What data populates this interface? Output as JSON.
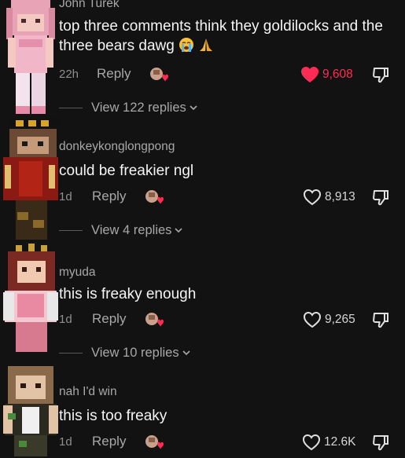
{
  "comments": [
    {
      "username": "John Turek",
      "text": "top three comments think they goldilocks and the three bears dawg",
      "emojis": [
        "loudly-crying-face-emoji",
        "folded-hands-emoji"
      ],
      "time": "22h",
      "reply_label": "Reply",
      "likes": "9,608",
      "liked": true,
      "view_replies": "View 122 replies"
    },
    {
      "username": "donkeykonglongpong",
      "text": "could be freakier ngl",
      "time": "1d",
      "reply_label": "Reply",
      "likes": "8,913",
      "liked": false,
      "view_replies": "View 4 replies"
    },
    {
      "username": "myuda",
      "text": "this is freaky enough",
      "time": "1d",
      "reply_label": "Reply",
      "likes": "9,265",
      "liked": false,
      "view_replies": "View 10 replies"
    },
    {
      "username": "nah I'd win",
      "text": "this is too freaky",
      "time": "1d",
      "reply_label": "Reply",
      "likes": "12.6K",
      "liked": false
    }
  ],
  "colors": {
    "background": "#121212",
    "like_active": "#fe2c55",
    "muted": "#a8a8a8"
  }
}
